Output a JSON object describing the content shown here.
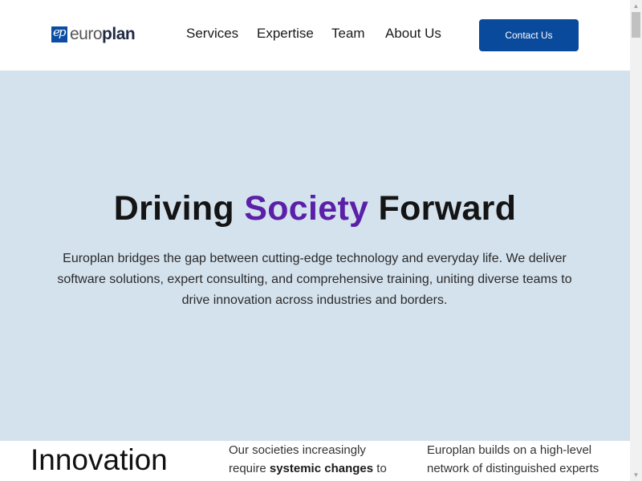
{
  "header": {
    "logo": {
      "mark": "ep",
      "text_light": "euro",
      "text_bold": "plan"
    },
    "nav": [
      {
        "label": "Services"
      },
      {
        "label": "Expertise"
      },
      {
        "label": "Team"
      },
      {
        "label": "About Us"
      }
    ],
    "contact_label": "Contact Us"
  },
  "hero": {
    "title_before": "Driving ",
    "title_accent": "Society",
    "title_after": " Forward",
    "description": "Europlan bridges the gap between cutting-edge technology and everyday life. We deliver software solutions, expert consulting, and comprehensive training, uniting diverse teams to drive innovation across industries and borders."
  },
  "innovation": {
    "heading": "Innovation",
    "col1_line1": "Our societies increasingly",
    "col1_before": "require ",
    "col1_bold": "systemic changes",
    "col1_after": " to",
    "col2_line1": "Europlan builds on a high-level",
    "col2_line2": "network of distinguished experts"
  },
  "colors": {
    "brand_blue": "#0a4a9c",
    "accent_purple": "#5b1fa8",
    "hero_background": "#d4e2ee"
  },
  "icons": {
    "scroll_up": "▲",
    "scroll_down": "▼"
  }
}
